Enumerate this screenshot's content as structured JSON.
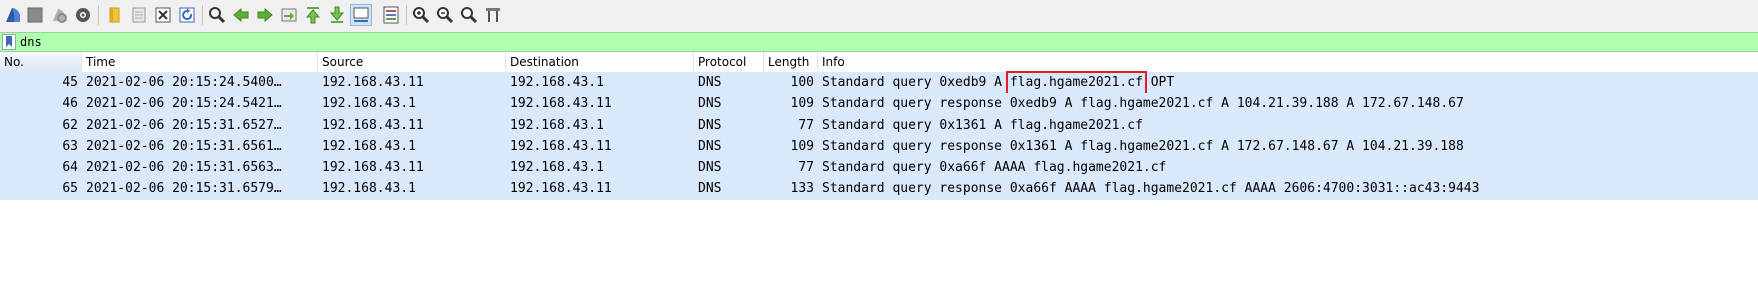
{
  "toolbar": {
    "buttons": [
      {
        "name": "start-capture-icon"
      },
      {
        "name": "stop-capture-icon"
      },
      {
        "name": "restart-capture-icon"
      },
      {
        "name": "capture-options-icon"
      },
      {
        "name": "open-file-icon"
      },
      {
        "name": "save-file-icon"
      },
      {
        "name": "close-file-icon"
      },
      {
        "name": "reload-file-icon"
      },
      {
        "name": "find-packet-icon"
      },
      {
        "name": "go-back-icon"
      },
      {
        "name": "go-forward-icon"
      },
      {
        "name": "go-to-packet-icon"
      },
      {
        "name": "go-first-packet-icon"
      },
      {
        "name": "go-last-packet-icon"
      },
      {
        "name": "autoscroll-icon"
      },
      {
        "name": "colorize-icon"
      },
      {
        "name": "zoom-in-icon"
      },
      {
        "name": "zoom-out-icon"
      },
      {
        "name": "normal-size-icon"
      },
      {
        "name": "resize-columns-icon"
      }
    ]
  },
  "filter": {
    "value": "dns",
    "background": "#afffaf"
  },
  "columns": {
    "no": "No.",
    "time": "Time",
    "source": "Source",
    "destination": "Destination",
    "protocol": "Protocol",
    "length": "Length",
    "info": "Info"
  },
  "rows": [
    {
      "no": "45",
      "time": "2021-02-06 20:15:24.5400…",
      "source": "192.168.43.11",
      "destination": "192.168.43.1",
      "protocol": "DNS",
      "length": "100",
      "info_pre": "Standard query 0xedb9 A ",
      "info_hl": "flag.hgame2021.cf",
      "info_post": " OPT"
    },
    {
      "no": "46",
      "time": "2021-02-06 20:15:24.5421…",
      "source": "192.168.43.1",
      "destination": "192.168.43.11",
      "protocol": "DNS",
      "length": "109",
      "info": "Standard query response 0xedb9 A flag.hgame2021.cf A 104.21.39.188 A 172.67.148.67"
    },
    {
      "no": "62",
      "time": "2021-02-06 20:15:31.6527…",
      "source": "192.168.43.11",
      "destination": "192.168.43.1",
      "protocol": "DNS",
      "length": "77",
      "info": "Standard query 0x1361 A flag.hgame2021.cf"
    },
    {
      "no": "63",
      "time": "2021-02-06 20:15:31.6561…",
      "source": "192.168.43.1",
      "destination": "192.168.43.11",
      "protocol": "DNS",
      "length": "109",
      "info": "Standard query response 0x1361 A flag.hgame2021.cf A 172.67.148.67 A 104.21.39.188"
    },
    {
      "no": "64",
      "time": "2021-02-06 20:15:31.6563…",
      "source": "192.168.43.11",
      "destination": "192.168.43.1",
      "protocol": "DNS",
      "length": "77",
      "info": "Standard query 0xa66f AAAA flag.hgame2021.cf"
    },
    {
      "no": "65",
      "time": "2021-02-06 20:15:31.6579…",
      "source": "192.168.43.1",
      "destination": "192.168.43.11",
      "protocol": "DNS",
      "length": "133",
      "info": "Standard query response 0xa66f AAAA flag.hgame2021.cf AAAA 2606:4700:3031::ac43:9443"
    }
  ],
  "colors": {
    "row_background": "#d9e8fb",
    "highlight_box": "#e02020"
  }
}
